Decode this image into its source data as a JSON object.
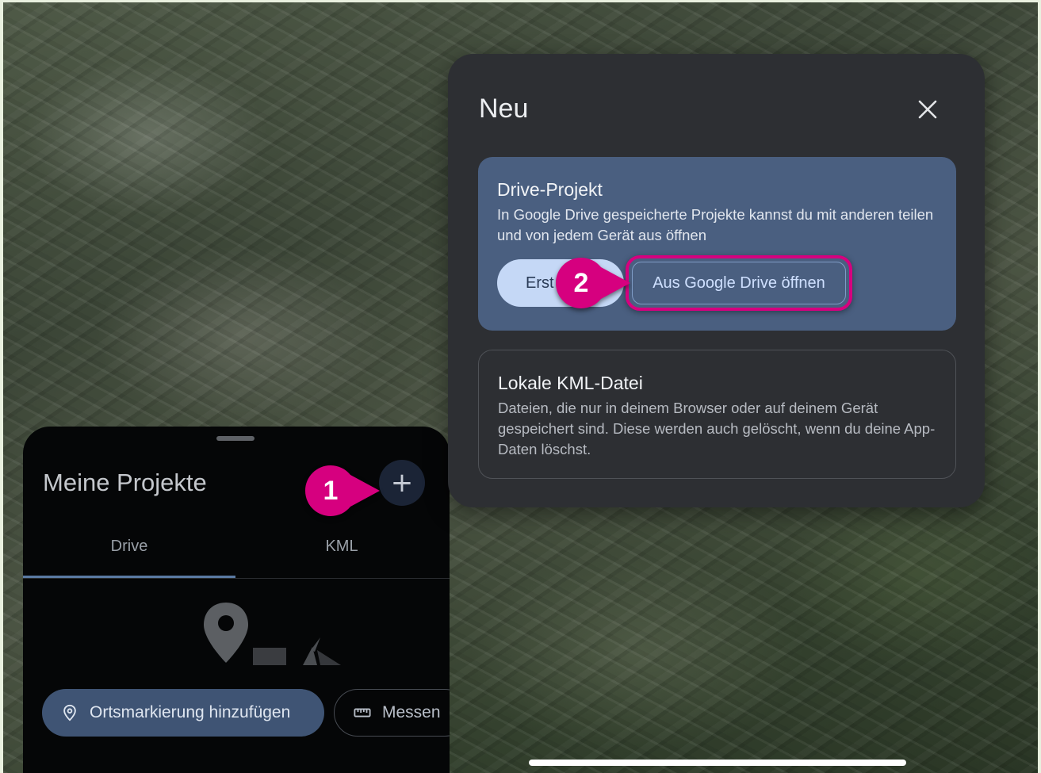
{
  "background": {
    "description_icon": "satellite-terrain"
  },
  "projects_panel": {
    "title": "Meine Projekte",
    "add_icon": "+",
    "tabs": [
      {
        "label": "Drive",
        "selected": true
      },
      {
        "label": "KML",
        "selected": false
      }
    ],
    "actions": {
      "placemark_label": "Ortsmarkierung hinzufügen",
      "measure_label": "Messen"
    }
  },
  "dialog": {
    "title": "Neu",
    "close_icon": "×",
    "drive_card": {
      "title": "Drive-Projekt",
      "description": "In Google Drive gespeicherte Projekte kannst du mit anderen teilen und von jedem Gerät aus öffnen",
      "create_label": "Erst",
      "open_label": "Aus Google Drive öffnen"
    },
    "kml_card": {
      "title": "Lokale KML-Datei",
      "description": "Dateien, die nur in deinem Browser oder auf deinem Gerät gespeichert sind. Diese werden auch gelöscht, wenn du deine App-Daten löschst."
    }
  },
  "callouts": {
    "one": "1",
    "two": "2"
  },
  "colors": {
    "accent_magenta": "#d6007f",
    "drive_card_bg": "#4a5f80",
    "dialog_bg": "#2d2f33",
    "panel_bg": "#050607"
  }
}
